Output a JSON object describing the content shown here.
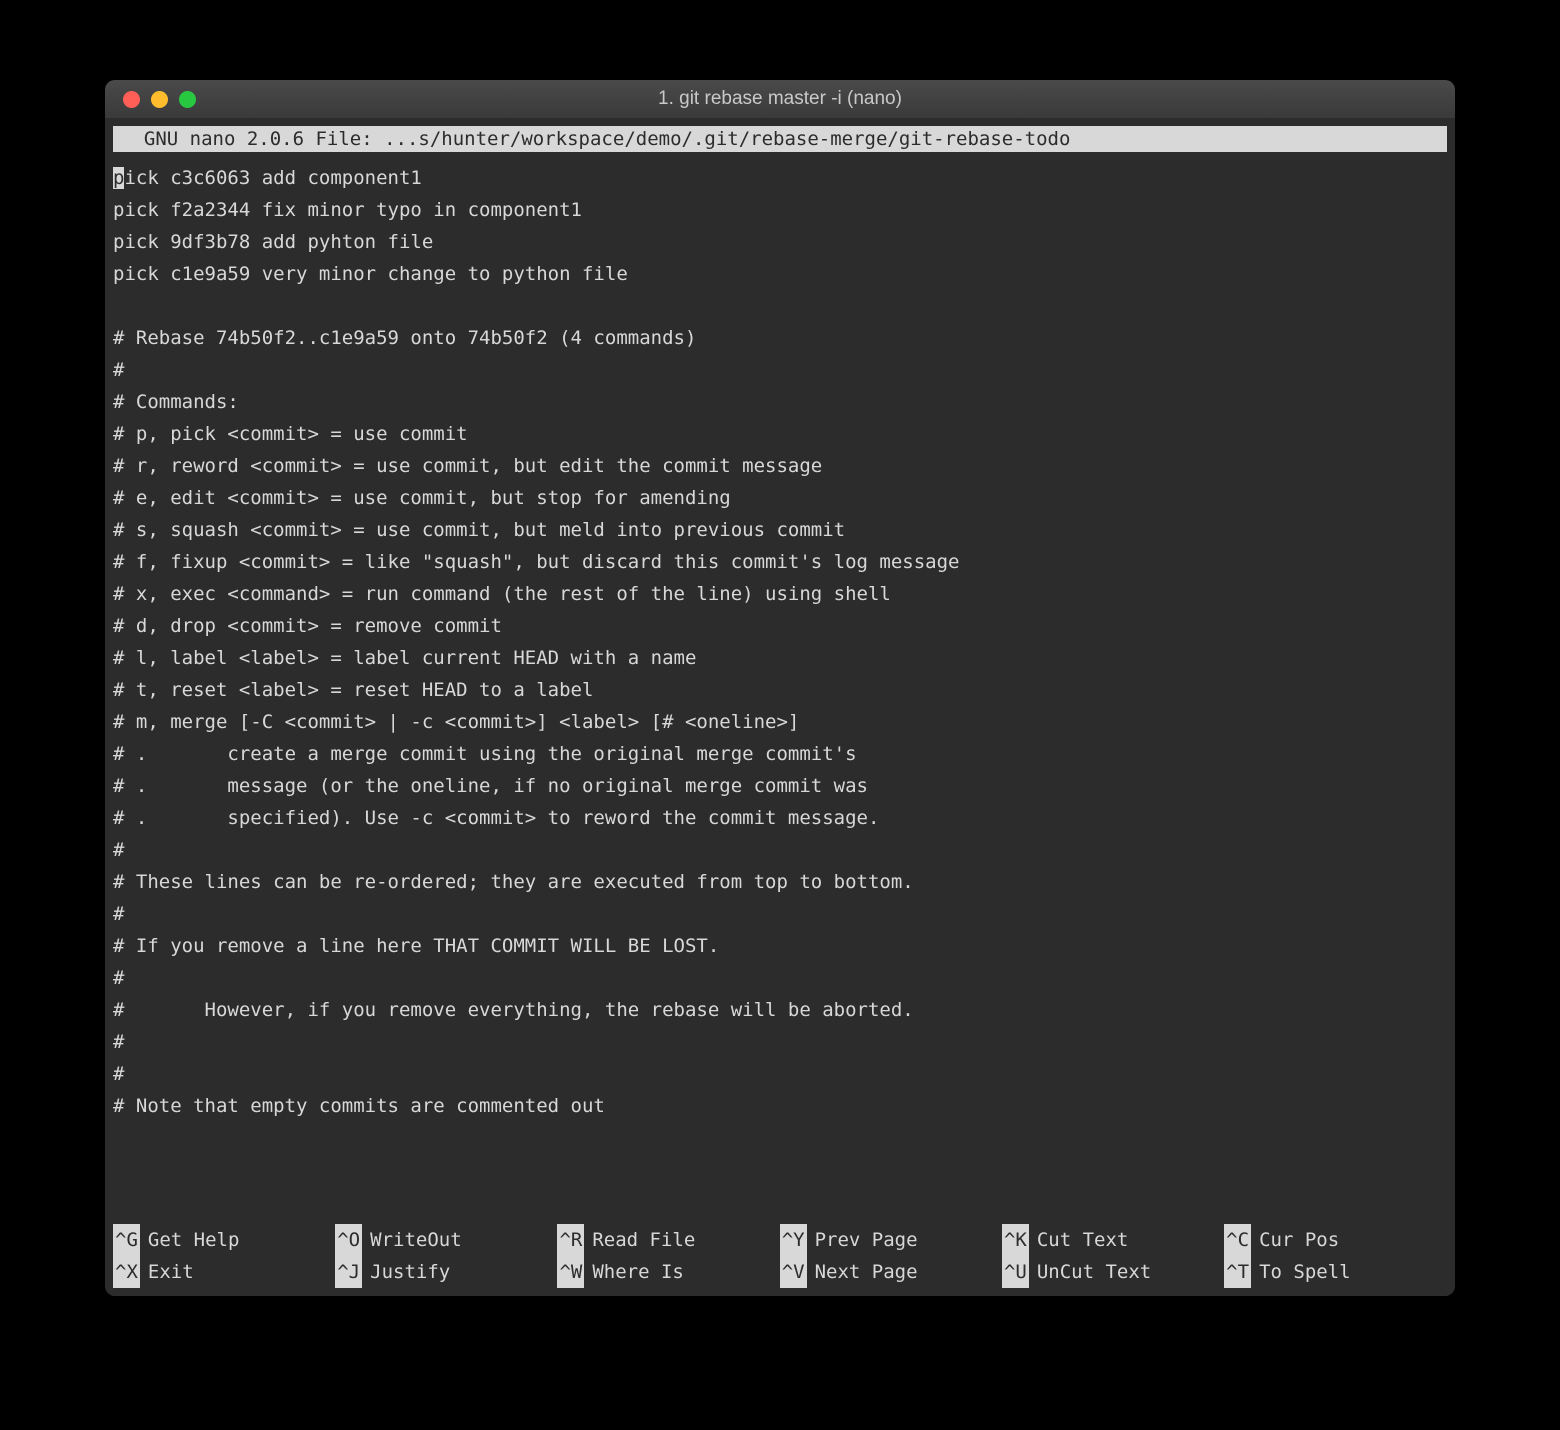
{
  "window": {
    "title": "1. git rebase master -i (nano)"
  },
  "nano": {
    "header": "  GNU nano 2.0.6 File: ...s/hunter/workspace/demo/.git/rebase-merge/git-rebase-todo              "
  },
  "editor": {
    "cursor_char": "p",
    "first_line_rest": "ick c3c6063 add component1",
    "lines": [
      "pick f2a2344 fix minor typo in component1",
      "pick 9df3b78 add pyhton file",
      "pick c1e9a59 very minor change to python file",
      "",
      "# Rebase 74b50f2..c1e9a59 onto 74b50f2 (4 commands)",
      "#",
      "# Commands:",
      "# p, pick <commit> = use commit",
      "# r, reword <commit> = use commit, but edit the commit message",
      "# e, edit <commit> = use commit, but stop for amending",
      "# s, squash <commit> = use commit, but meld into previous commit",
      "# f, fixup <commit> = like \"squash\", but discard this commit's log message",
      "# x, exec <command> = run command (the rest of the line) using shell",
      "# d, drop <commit> = remove commit",
      "# l, label <label> = label current HEAD with a name",
      "# t, reset <label> = reset HEAD to a label",
      "# m, merge [-C <commit> | -c <commit>] <label> [# <oneline>]",
      "# .       create a merge commit using the original merge commit's",
      "# .       message (or the oneline, if no original merge commit was",
      "# .       specified). Use -c <commit> to reword the commit message.",
      "#",
      "# These lines can be re-ordered; they are executed from top to bottom.",
      "#",
      "# If you remove a line here THAT COMMIT WILL BE LOST.",
      "#",
      "#       However, if you remove everything, the rebase will be aborted.",
      "#",
      "#",
      "# Note that empty commits are commented out"
    ]
  },
  "footer": {
    "row1": [
      {
        "key": "^G",
        "label": "Get Help"
      },
      {
        "key": "^O",
        "label": "WriteOut"
      },
      {
        "key": "^R",
        "label": "Read File"
      },
      {
        "key": "^Y",
        "label": "Prev Page"
      },
      {
        "key": "^K",
        "label": "Cut Text"
      },
      {
        "key": "^C",
        "label": "Cur Pos"
      }
    ],
    "row2": [
      {
        "key": "^X",
        "label": "Exit"
      },
      {
        "key": "^J",
        "label": "Justify"
      },
      {
        "key": "^W",
        "label": "Where Is"
      },
      {
        "key": "^V",
        "label": "Next Page"
      },
      {
        "key": "^U",
        "label": "UnCut Text"
      },
      {
        "key": "^T",
        "label": "To Spell"
      }
    ]
  }
}
